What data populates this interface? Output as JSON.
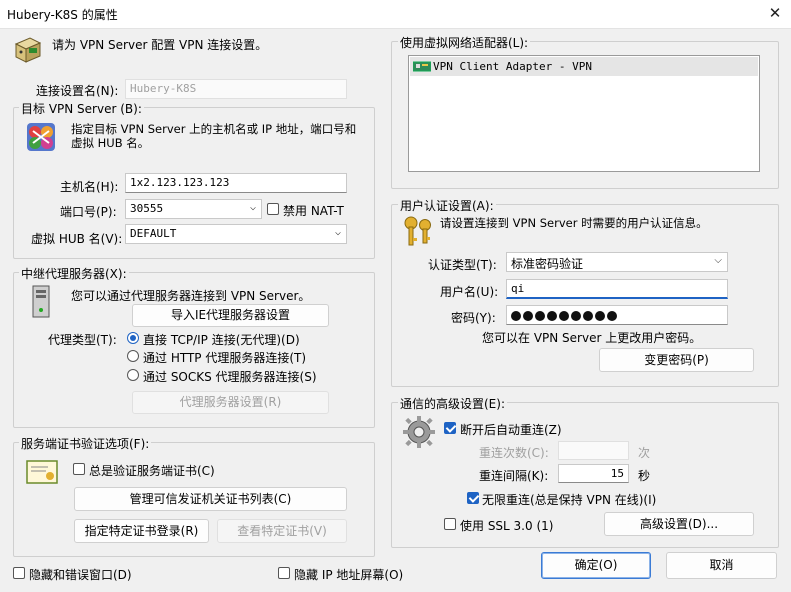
{
  "window": {
    "title": "Hubery-K8S 的属性",
    "close_glyph": "✕"
  },
  "intro": {
    "text": "请为 VPN Server 配置 VPN 连接设置。"
  },
  "connection_name": {
    "label": "连接设置名(N):",
    "value": "Hubery-K8S"
  },
  "target": {
    "legend": "目标 VPN Server (B):",
    "description": "指定目标 VPN Server 上的主机名或 IP 地址，端口号和虚拟 HUB 名。",
    "hostname_label": "主机名(H):",
    "hostname_value": "1x2.123.123.123",
    "port_label": "端口号(P):",
    "port_value": "30555",
    "disable_nat_label": "禁用 NAT-T",
    "hub_label": "虚拟 HUB 名(V):",
    "hub_value": "DEFAULT"
  },
  "proxy": {
    "legend": "中继代理服务器(X):",
    "description": "您可以通过代理服务器连接到 VPN Server。",
    "import_ie_button": "导入IE代理服务器设置",
    "type_label": "代理类型(T):",
    "options": [
      "直接 TCP/IP 连接(无代理)(D)",
      "通过 HTTP 代理服务器连接(T)",
      "通过 SOCKS 代理服务器连接(S)"
    ],
    "selected_index": 0,
    "settings_button": "代理服务器设置(R)"
  },
  "server_cert": {
    "legend": "服务端证书验证选项(F):",
    "always_verify_label": "总是验证服务端证书(C)",
    "manage_ca_button": "管理可信发证机关证书列表(C)",
    "specify_cert_button": "指定特定证书登录(R)",
    "view_cert_button": "查看特定证书(V)"
  },
  "adapter": {
    "legend": "使用虚拟网络适配器(L):",
    "items": [
      "VPN Client Adapter - VPN"
    ]
  },
  "auth": {
    "legend": "用户认证设置(A):",
    "description": "请设置连接到 VPN Server 时需要的用户认证信息。",
    "type_label": "认证类型(T):",
    "type_value": "标准密码验证",
    "username_label": "用户名(U):",
    "username_value": "qi",
    "password_label": "密码(Y):",
    "password_length": 9,
    "change_hint": "您可以在 VPN Server 上更改用户密码。",
    "change_password_button": "变更密码(P)"
  },
  "advanced": {
    "legend": "通信的高级设置(E):",
    "auto_reconnect_label": "断开后自动重连(Z)",
    "retry_count_label": "重连次数(C):",
    "retry_count_value": "",
    "retry_count_unit": "次",
    "retry_interval_label": "重连间隔(K):",
    "retry_interval_value": "15",
    "retry_interval_unit": "秒",
    "infinite_retry_label": "无限重连(总是保持 VPN 在线)(I)",
    "use_ssl3_label": "使用 SSL 3.0 (1)",
    "advanced_button": "高级设置(D)..."
  },
  "footer": {
    "hide_status_label": "隐藏和错误窗口(D)",
    "hide_ip_label": "隐藏 IP 地址屏幕(O)",
    "ok_button": "确定(O)",
    "cancel_button": "取消"
  },
  "states": {
    "disable_nat": false,
    "always_verify": false,
    "auto_reconnect": true,
    "infinite_retry": true,
    "use_ssl3": false,
    "hide_status": false,
    "hide_ip": false
  },
  "icons": {
    "intro": "computer-network-icon",
    "target": "server-target-icon",
    "proxy": "computer-tower-icon",
    "cert": "certificate-icon",
    "adapter": "network-adapter-icon",
    "auth": "keys-icon",
    "advanced": "gear-icon"
  },
  "colors": {
    "accent": "#1e63c4",
    "window_bg": "#f0f0f0"
  }
}
